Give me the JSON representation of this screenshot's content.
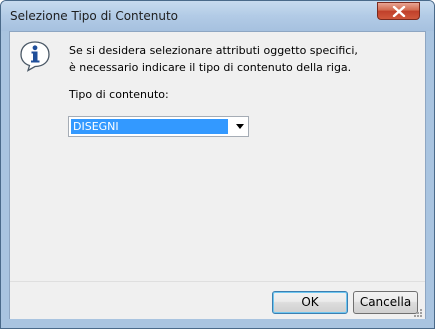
{
  "window": {
    "title": "Selezione Tipo di Contenuto"
  },
  "dialog": {
    "icon": "info-icon",
    "message_line1": "Se si desidera selezionare attributi oggetto specifici,",
    "message_line2": "è necessario indicare il tipo di contenuto della riga.",
    "field_label": "Tipo di contenuto:",
    "content_type_value": "DISEGNI"
  },
  "buttons": {
    "ok_label": "OK",
    "cancel_label": "Cancella"
  },
  "colors": {
    "selection": "#3399ff",
    "close_button": "#c0402a",
    "title_bar": "#b2cbe6"
  }
}
